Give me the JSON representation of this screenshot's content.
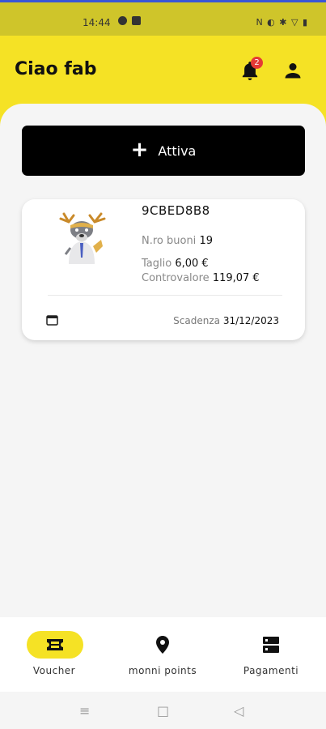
{
  "status_bar": {
    "time": "14:44",
    "right_icons": "N ◐ ✱ ▽ ▮"
  },
  "header": {
    "title": "Ciao fab",
    "notifications_count": "2",
    "background_color": "#f5e225"
  },
  "activate_button": {
    "label": "Attiva"
  },
  "voucher": {
    "code": "9CBED8B8",
    "count_label": "N.ro buoni",
    "count_value": "19",
    "denomination_label": "Taglio",
    "denomination_value": "6,00 €",
    "total_label": "Controvalore",
    "total_value": "119,07 €",
    "expiry_label": "Scadenza",
    "expiry_value": "31/12/2023"
  },
  "bottom_nav": {
    "items": [
      {
        "label": "Voucher",
        "icon": "ticket-icon",
        "active": true
      },
      {
        "label": "monni points",
        "icon": "location-pin-icon",
        "active": false
      },
      {
        "label": "Pagamenti",
        "icon": "server-icon",
        "active": false
      }
    ]
  },
  "system_nav": {
    "menu": "≡",
    "home": "□",
    "back": "◁"
  }
}
